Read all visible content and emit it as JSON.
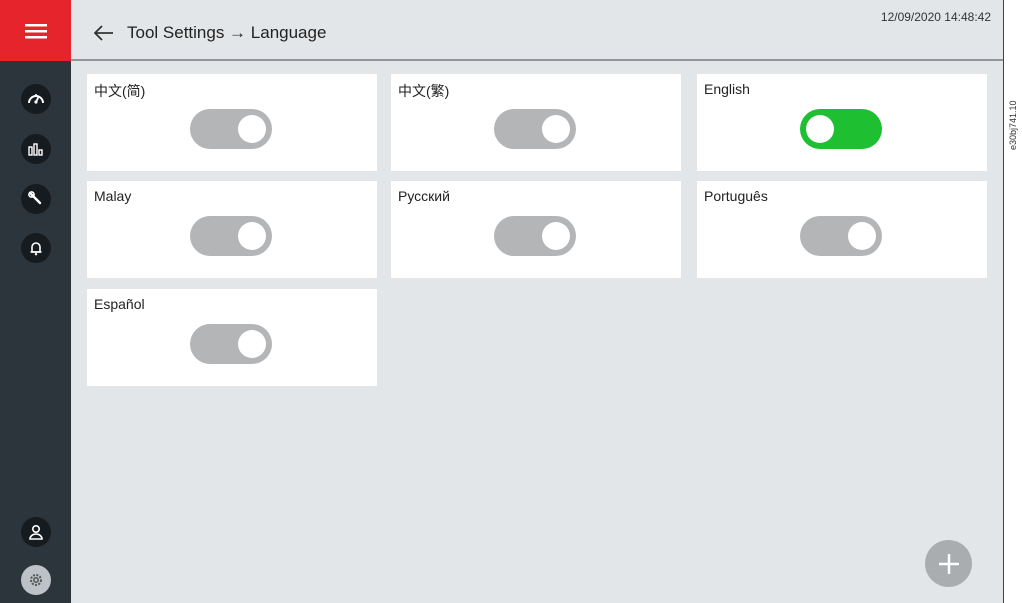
{
  "header": {
    "title": "Tool Settings → Language",
    "datetime": "12/09/2020 14:48:42"
  },
  "sidebar": {
    "menu_icon": "hamburger-menu-icon",
    "items": [
      {
        "name": "gauge-icon"
      },
      {
        "name": "chart-icon"
      },
      {
        "name": "wrench-icon"
      },
      {
        "name": "bell-icon"
      }
    ],
    "bottom": [
      {
        "name": "user-icon"
      },
      {
        "name": "gear-icon"
      }
    ]
  },
  "languages": [
    {
      "label": "中文(简)",
      "enabled": false
    },
    {
      "label": "中文(繁)",
      "enabled": false
    },
    {
      "label": "English",
      "enabled": true
    },
    {
      "label": "Malay",
      "enabled": false
    },
    {
      "label": "Русский",
      "enabled": false
    },
    {
      "label": "Português",
      "enabled": false
    },
    {
      "label": "Español",
      "enabled": false
    }
  ],
  "fab": {
    "icon": "plus-icon"
  },
  "doc_reference": "e30bj741.10",
  "colors": {
    "accent_red": "#e5242b",
    "toggle_on": "#1fbf32",
    "toggle_off": "#b3b5b7",
    "sidebar": "#2d353c"
  }
}
